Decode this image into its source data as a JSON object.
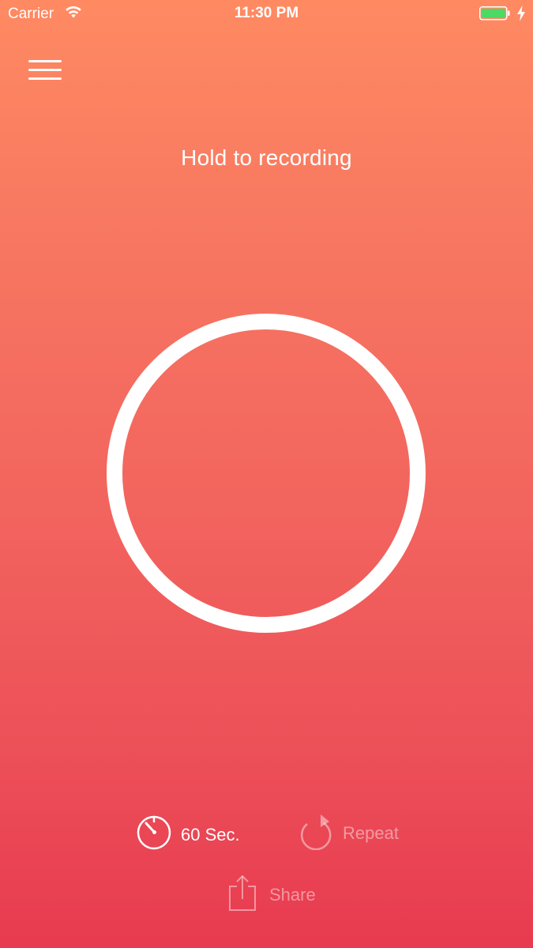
{
  "status_bar": {
    "carrier": "Carrier",
    "time": "11:30 PM",
    "icons": [
      "wifi-icon",
      "battery-icon",
      "charging-icon"
    ],
    "battery_color": "#4cd964"
  },
  "header": {
    "menu_icon": "hamburger-menu-icon",
    "instruction": "Hold to recording"
  },
  "record": {
    "icon": "record-ring"
  },
  "controls": {
    "timer": {
      "icon": "timer-icon",
      "label": "60 Sec."
    },
    "repeat": {
      "icon": "repeat-icon",
      "label": "Repeat"
    },
    "share": {
      "icon": "share-icon",
      "label": "Share"
    }
  },
  "colors": {
    "gradient_top": "#ff8a62",
    "gradient_bottom": "#e83a50",
    "foreground": "#ffffff"
  }
}
